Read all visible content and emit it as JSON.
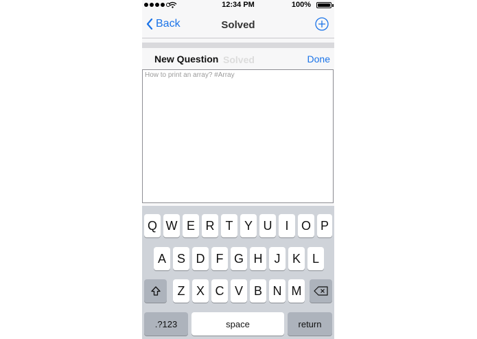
{
  "status_bar": {
    "time": "12:34 PM",
    "battery": "100%"
  },
  "nav": {
    "back_label": "Back",
    "title": "Solved"
  },
  "sheet": {
    "title": "New Question",
    "underlying_title": "Solved",
    "done_label": "Done",
    "placeholder": "How to print an array? #Array"
  },
  "keyboard": {
    "row1": [
      "Q",
      "W",
      "E",
      "R",
      "T",
      "Y",
      "U",
      "I",
      "O",
      "P"
    ],
    "row2": [
      "A",
      "S",
      "D",
      "F",
      "G",
      "H",
      "J",
      "K",
      "L"
    ],
    "row3": [
      "Z",
      "X",
      "C",
      "V",
      "B",
      "N",
      "M"
    ],
    "numbers_label": ".?123",
    "space_label": "space",
    "return_label": "return"
  },
  "icons": {
    "back": "chevron-left-icon",
    "add": "plus-circle-icon",
    "shift": "shift-icon",
    "delete": "backspace-icon",
    "wifi": "wifi-icon",
    "battery": "battery-icon"
  },
  "colors": {
    "accent": "#1a73e8",
    "keyboard_bg": "#cfd3d9"
  }
}
